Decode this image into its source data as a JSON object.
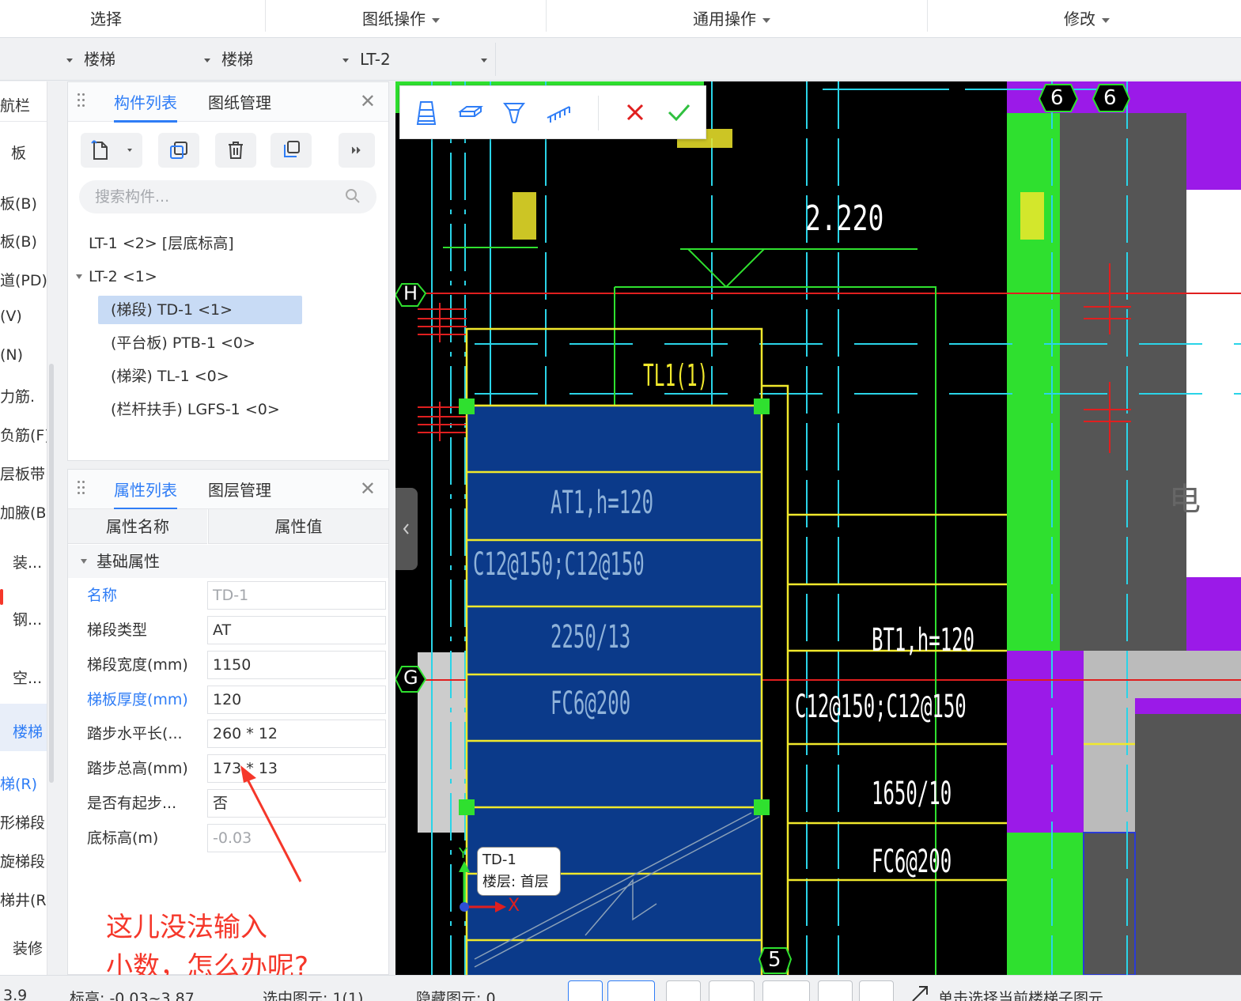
{
  "ribbon": {
    "select": "选择",
    "drawing_ops": "图纸操作",
    "general_ops": "通用操作",
    "modify": "修改"
  },
  "selectors": [
    {
      "value": "楼梯"
    },
    {
      "value": "楼梯"
    },
    {
      "value": "LT-2"
    }
  ],
  "left_nav": {
    "title": "航栏",
    "items": [
      "板",
      "板(B)",
      "板(B)",
      "道(PD)",
      "(V)",
      "(N)",
      "力筋.",
      "负筋(F)",
      "层板带.",
      "加腋(B)",
      "装...",
      "钢...",
      "空...",
      "楼梯",
      "梯(R)",
      "形梯段.",
      "旋梯段.",
      "梯井(R)",
      "装修"
    ]
  },
  "component_panel": {
    "tab_list": "构件列表",
    "tab_drawings": "图纸管理",
    "search_placeholder": "搜索构件...",
    "tree": [
      {
        "label": "LT-1 <2> [层底标高]",
        "level": 0
      },
      {
        "label": "LT-2 <1>",
        "level": 0,
        "expanded": true
      },
      {
        "label": "(梯段) TD-1 <1>",
        "level": 1,
        "selected": true
      },
      {
        "label": "(平台板) PTB-1 <0>",
        "level": 1
      },
      {
        "label": "(梯梁) TL-1 <0>",
        "level": 1
      },
      {
        "label": "(栏杆扶手) LGFS-1 <0>",
        "level": 1
      }
    ]
  },
  "property_panel": {
    "tab_props": "属性列表",
    "tab_layers": "图层管理",
    "col_name": "属性名称",
    "col_value": "属性值",
    "section": "基础属性",
    "rows": [
      {
        "name": "名称",
        "value": "TD-1",
        "blue": true,
        "readonly": true
      },
      {
        "name": "梯段类型",
        "value": "AT"
      },
      {
        "name": "梯段宽度(mm)",
        "value": "1150"
      },
      {
        "name": "梯板厚度(mm)",
        "value": "120",
        "blue": true
      },
      {
        "name": "踏步水平长(...",
        "value": "260 * 12"
      },
      {
        "name": "踏步总高(mm)",
        "value": "173 * 13"
      },
      {
        "name": "是否有起步...",
        "value": "否"
      },
      {
        "name": "底标高(m)",
        "value": "-0.03",
        "readonly": true
      }
    ]
  },
  "annotation": {
    "line1": "这儿没法输入",
    "line2": "小数，怎么办呢?"
  },
  "canvas": {
    "axis_labels": {
      "h": "H",
      "g": "G",
      "six_a": "6",
      "six_b": "6",
      "five": "5"
    },
    "texts": {
      "elevation": "2.220",
      "beam": "TL1(1)",
      "flight_name": "AT1,h=120",
      "flight_rebar": "C12@150;C12@150",
      "flight_steps": "2250/13",
      "flight_dist": "FC6@200",
      "bt_name": "BT1,h=120",
      "bt_rebar": "C12@150;C12@150",
      "bt_steps": "1650/10",
      "bt_dist": "FC6@200",
      "partial_right": "电"
    },
    "axis_x": "X",
    "axis_y": "Y",
    "tooltip_name": "TD-1",
    "tooltip_floor": "楼层: 首层"
  },
  "status": {
    "left_num": "3.9",
    "elevation": "标高: -0.03~3.87",
    "selected": "选中图元: 1(1)",
    "hidden": "隐藏图元: 0",
    "hint": "单击选择当前楼梯子图元"
  },
  "colors": {
    "accent": "#2f7df6",
    "canvas_bg": "#000000",
    "flight_fill": "#0b3a8a",
    "yellow": "#f0e82c",
    "green": "#2fe02f",
    "purple": "#9b1ae8",
    "annotation_red": "#f5372a"
  }
}
